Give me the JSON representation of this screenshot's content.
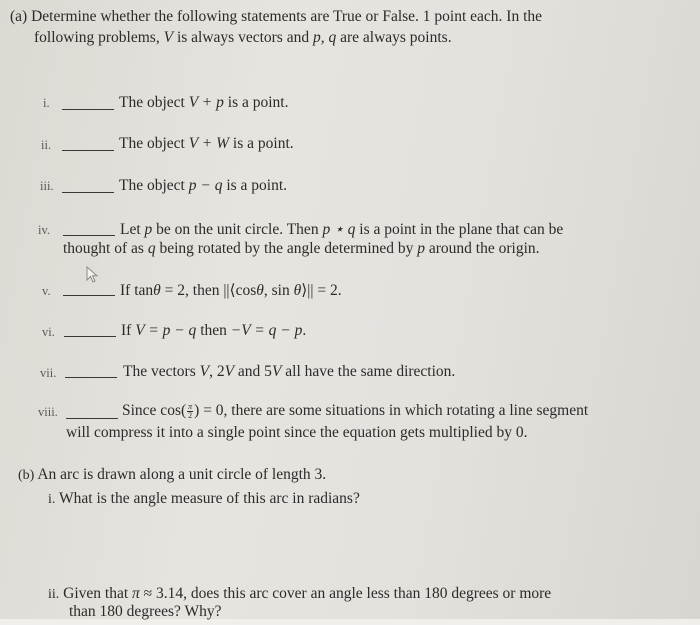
{
  "part_a": {
    "label": "(a)",
    "intro_line1": "Determine whether the following statements are True or False. 1 point each. In the",
    "intro_line2_pre": "following problems,",
    "intro_V": "V",
    "intro_line2_mid": "is always vectors and",
    "intro_pq": "p, q",
    "intro_line2_post": "are always points.",
    "items": [
      {
        "num": "i.",
        "pre": "The object",
        "math": "V + p",
        "post": "is a point."
      },
      {
        "num": "ii.",
        "pre": "The object",
        "math": "V + W",
        "post": "is a point."
      },
      {
        "num": "iii.",
        "pre": "The object",
        "math": "p − q",
        "post": "is a point."
      },
      {
        "num": "iv.",
        "line1_a": "Let",
        "line1_p": "p",
        "line1_b": "be on the unit circle. Then",
        "line1_math": "p ⋆ q",
        "line1_c": "is a point in the plane that can be",
        "line2_a": "thought of as",
        "line2_q": "q",
        "line2_b": "being rotated by the angle determined by",
        "line2_p": "p",
        "line2_c": "around the origin."
      },
      {
        "num": "v.",
        "pre": "If tan",
        "theta": "θ",
        "mid": "= 2, then ||⟨cos",
        "theta2": "θ",
        "mid2": ", sin",
        "theta3": "θ",
        "post": "⟩|| = 2."
      },
      {
        "num": "vi.",
        "pre": "If",
        "math1": "V = p − q",
        "mid": "then",
        "math2": "−V = q − p",
        "post": "."
      },
      {
        "num": "vii.",
        "pre": "The vectors",
        "v1": "V",
        "sep1": ", 2",
        "v2": "V",
        "sep2": "and 5",
        "v3": "V",
        "post": "all have the same direction."
      },
      {
        "num": "viii.",
        "line1_pre": "Since cos(",
        "frac_top": "π",
        "frac_bot": "2",
        "line1_post": ") = 0, there are some situations in which rotating a line segment",
        "line2": "will compress it into a single point since the equation gets multiplied by 0."
      }
    ]
  },
  "part_b": {
    "label": "(b)",
    "intro": "An arc is drawn along a unit circle of length 3.",
    "q1_num": "i.",
    "q1": "What is the angle measure of this arc in radians?",
    "q2_num": "ii.",
    "q2_pre": "Given that",
    "q2_pi": "π",
    "q2_line1_post": "≈ 3.14, does this arc cover an angle less than 180 degrees or more",
    "q2_line2": "than 180 degrees? Why?"
  },
  "cursor": {
    "icon": "mouse-pointer-icon"
  }
}
